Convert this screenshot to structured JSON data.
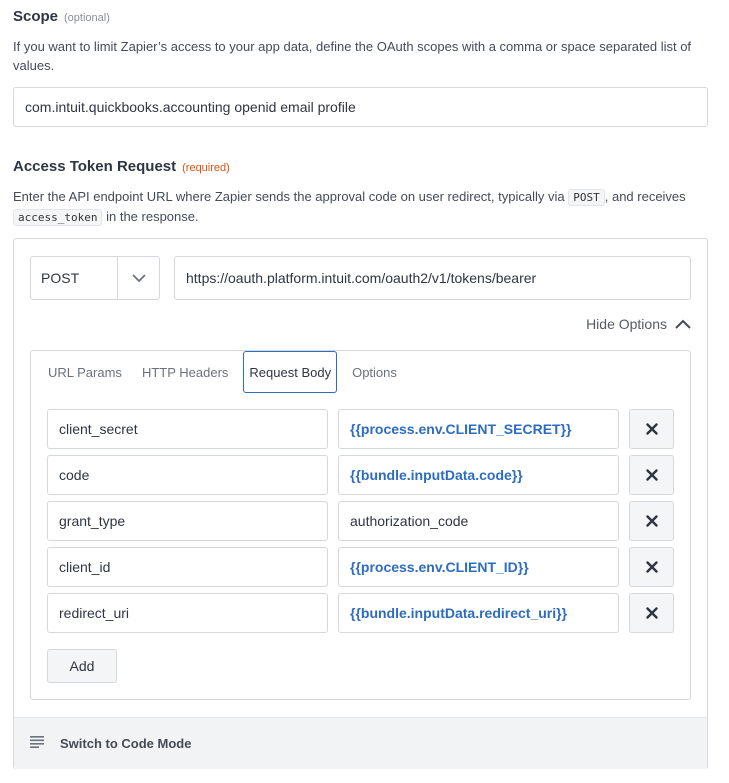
{
  "scope": {
    "label": "Scope",
    "hint": "(optional)",
    "help": "If you want to limit Zapier’s access to your app data, define the OAuth scopes with a comma or space separated list of values.",
    "value": "com.intuit.quickbooks.accounting openid email profile"
  },
  "access_token_request": {
    "label": "Access Token Request",
    "hint": "(required)",
    "help_part1": "Enter the API endpoint URL where Zapier sends the approval code on user redirect, typically via",
    "help_code1": "POST",
    "help_part2": ", and receives",
    "help_code2": "access_token",
    "help_part3": "in the response.",
    "method": "POST",
    "url": "https://oauth.platform.intuit.com/oauth2/v1/tokens/bearer",
    "hide_options_label": "Hide Options",
    "tabs": [
      {
        "label": "URL Params"
      },
      {
        "label": "HTTP Headers"
      },
      {
        "label": "Request Body"
      },
      {
        "label": "Options"
      }
    ],
    "active_tab": "Request Body",
    "body_rows": [
      {
        "key": "client_secret",
        "value": "{{process.env.CLIENT_SECRET}}"
      },
      {
        "key": "code",
        "value": "{{bundle.inputData.code}}"
      },
      {
        "key": "grant_type",
        "value": "authorization_code"
      },
      {
        "key": "client_id",
        "value": "{{process.env.CLIENT_ID}}"
      },
      {
        "key": "redirect_uri",
        "value": "{{bundle.inputData.redirect_uri}}"
      }
    ],
    "add_label": "Add",
    "code_mode_label": "Switch to Code Mode"
  },
  "icons": {
    "caret": "chevron-down-icon",
    "hide": "chevron-up-icon",
    "delete": "close-icon",
    "code_mode": "lines-icon"
  },
  "colors": {
    "accent": "#2d6cc0",
    "required": "#e0520e"
  }
}
